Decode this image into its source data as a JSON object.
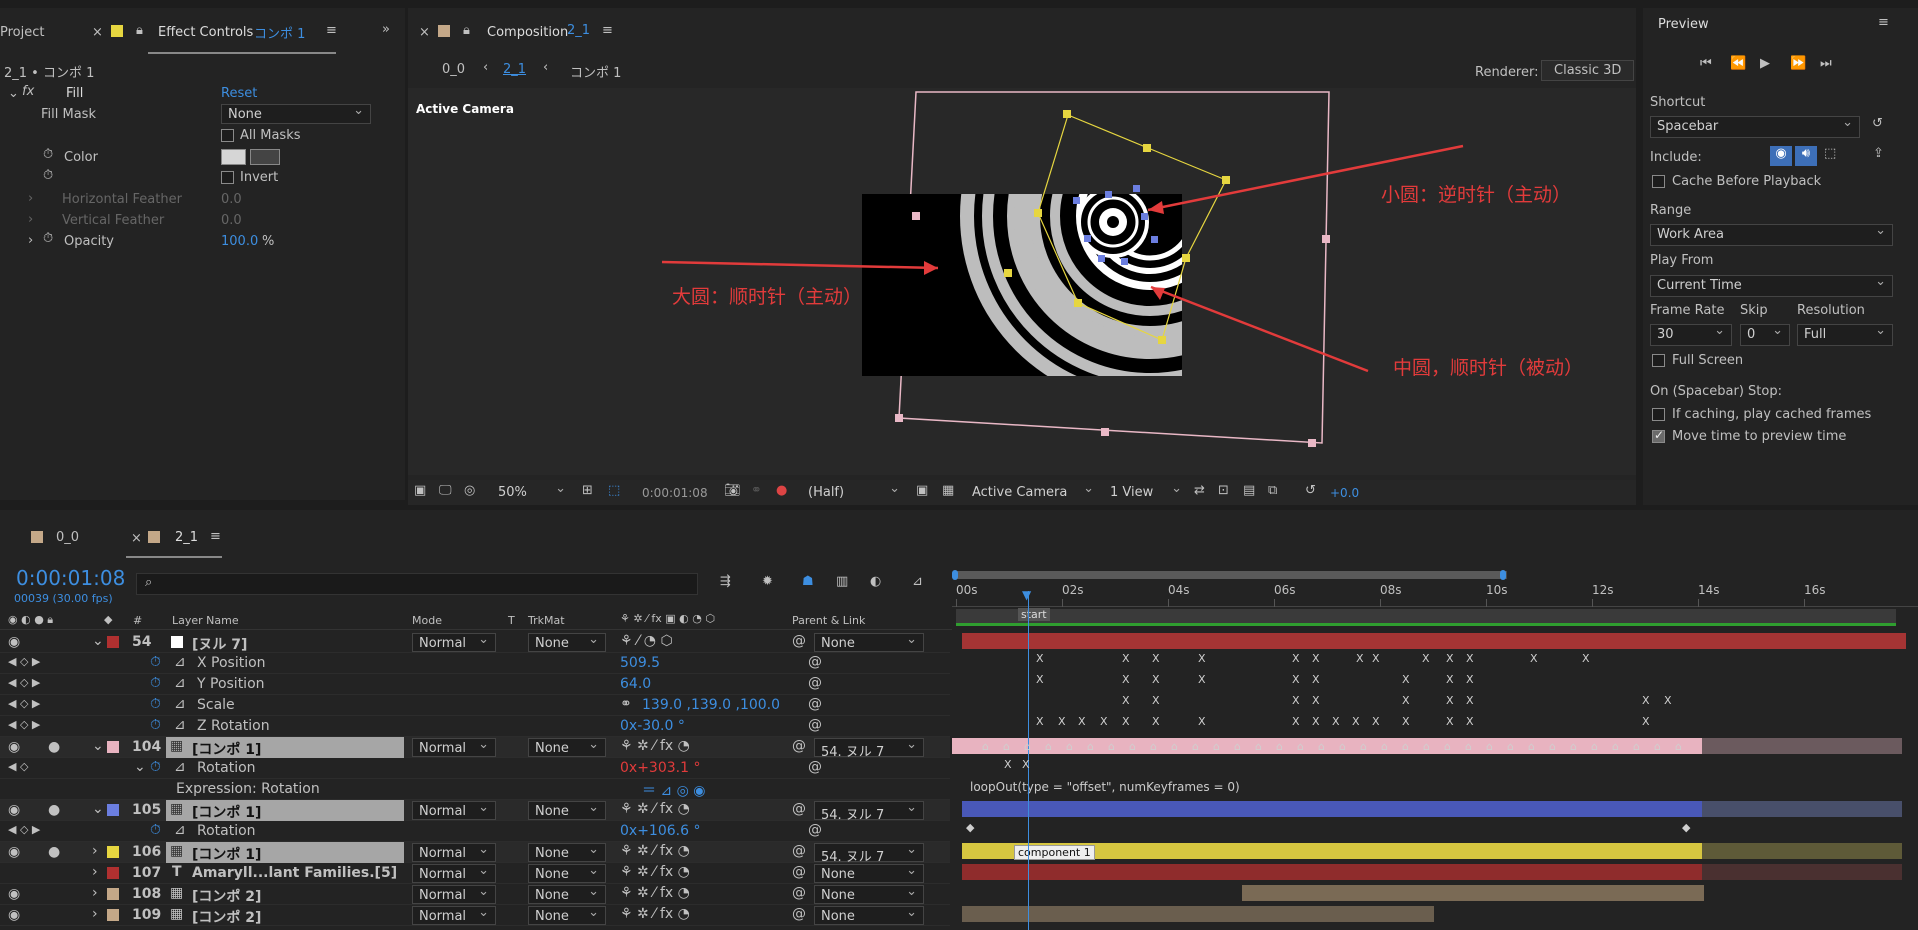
{
  "effect_panel": {
    "tab_project": "Project",
    "tab_effect": "Effect Controls",
    "tab_effect_target": "コンポ 1",
    "breadcrumb": "2_1 • コンポ 1",
    "effect_name": "Fill",
    "reset": "Reset",
    "fill_mask_label": "Fill Mask",
    "fill_mask_value": "None",
    "all_masks": "All Masks",
    "color_label": "Color",
    "invert": "Invert",
    "horizontal_feather": "Horizontal Feather",
    "horizontal_feather_value": "0.0",
    "vertical_feather": "Vertical Feather",
    "vertical_feather_value": "0.0",
    "opacity": "Opacity",
    "opacity_value": "100.0",
    "opacity_unit": "%"
  },
  "comp_panel": {
    "tab_label": "Composition",
    "tab_target": "2_1",
    "crumb1": "0_0",
    "crumb2": "2_1",
    "crumb3": "コンポ 1",
    "renderer_label": "Renderer:",
    "renderer_value": "Classic 3D",
    "active_camera": "Active Camera",
    "zoom": "50%",
    "timecode": "0:00:01:08",
    "resolution": "(Half)",
    "camera": "Active Camera",
    "views": "1 View",
    "exposure": "+0.0"
  },
  "annotations": {
    "small": "小圆：逆时针（主动）",
    "big": "大圆：顺时针（主动）",
    "mid": "中圆，顺时针（被动）"
  },
  "preview": {
    "title": "Preview",
    "shortcut_label": "Shortcut",
    "shortcut_value": "Spacebar",
    "include_label": "Include:",
    "cache_before": "Cache Before Playback",
    "range_label": "Range",
    "range_value": "Work Area",
    "play_from_label": "Play From",
    "play_from_value": "Current Time",
    "frame_rate_label": "Frame Rate",
    "frame_rate_value": "30",
    "skip_label": "Skip",
    "skip_value": "0",
    "resolution_label": "Resolution",
    "resolution_value": "Full",
    "full_screen": "Full Screen",
    "stop_label": "On (Spacebar) Stop:",
    "if_caching": "If caching, play cached frames",
    "move_time": "Move time to preview time"
  },
  "timeline": {
    "tab1": "0_0",
    "tab2": "2_1",
    "timecode": "0:00:01:08",
    "frames": "00039 (30.00 fps)",
    "col_layer": "Layer Name",
    "col_mode": "Mode",
    "col_t": "T",
    "col_trkmat": "TrkMat",
    "col_parent": "Parent & Link",
    "ruler": [
      "00s",
      "02s",
      "04s",
      "06s",
      "08s",
      "10s",
      "12s",
      "14s",
      "16s"
    ],
    "marker_start": "start",
    "marker_component": "component 1",
    "expression_text": "loopOut(type = \"offset\", numKeyframes = 0)"
  },
  "layers": [
    {
      "num": "54",
      "name": "[ヌル 7]",
      "mode": "Normal",
      "trk": "None",
      "parent": "None",
      "color": "#b03030"
    },
    {
      "prop": "X Position",
      "value": "509.5"
    },
    {
      "prop": "Y Position",
      "value": "64.0"
    },
    {
      "prop": "Scale",
      "value": "139.0 ,139.0 ,100.0"
    },
    {
      "prop": "Z Rotation",
      "value": "0x-30.0 °"
    },
    {
      "num": "104",
      "name": "[コンポ 1]",
      "mode": "Normal",
      "trk": "None",
      "parent": "54. ヌル 7",
      "color": "#e8b3c0"
    },
    {
      "prop": "Rotation",
      "value": "0x+303.1 °"
    },
    {
      "prop": "Expression: Rotation",
      "value": ""
    },
    {
      "num": "105",
      "name": "[コンポ 1]",
      "mode": "Normal",
      "trk": "None",
      "parent": "54. ヌル 7",
      "color": "#6b7ee0"
    },
    {
      "prop": "Rotation",
      "value": "0x+106.6 °"
    },
    {
      "num": "106",
      "name": "[コンポ 1]",
      "mode": "Normal",
      "trk": "None",
      "parent": "54. ヌル 7",
      "color": "#e6d640"
    },
    {
      "num": "107",
      "name": "Amaryll...lant Families.[5]",
      "mode": "Normal",
      "trk": "None",
      "parent": "None",
      "color": "#b03030"
    },
    {
      "num": "108",
      "name": "[コンポ 2]",
      "mode": "Normal",
      "trk": "None",
      "parent": "None",
      "color": "#c4a888"
    },
    {
      "num": "109",
      "name": "[コンポ 2]",
      "mode": "Normal",
      "trk": "None",
      "parent": "None",
      "color": "#c4a888"
    }
  ]
}
